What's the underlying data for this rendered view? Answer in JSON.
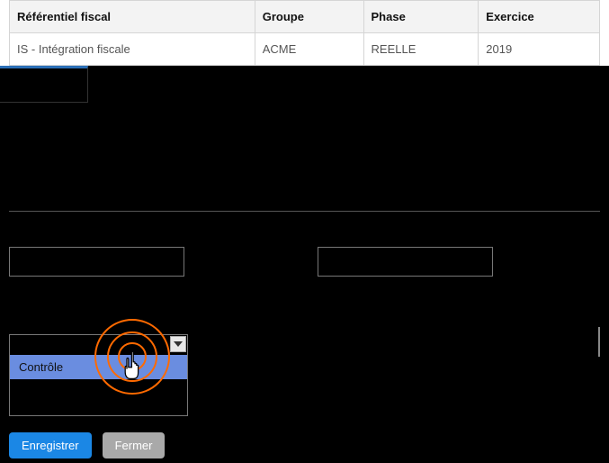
{
  "table": {
    "headers": [
      "Référentiel fiscal",
      "Groupe",
      "Phase",
      "Exercice"
    ],
    "row": [
      "IS - Intégration fiscale",
      "ACME",
      "REELLE",
      "2019"
    ]
  },
  "dropdown": {
    "options": [
      "Contrôle"
    ],
    "selected": "Contrôle"
  },
  "buttons": {
    "save": "Enregistrer",
    "close": "Fermer"
  }
}
